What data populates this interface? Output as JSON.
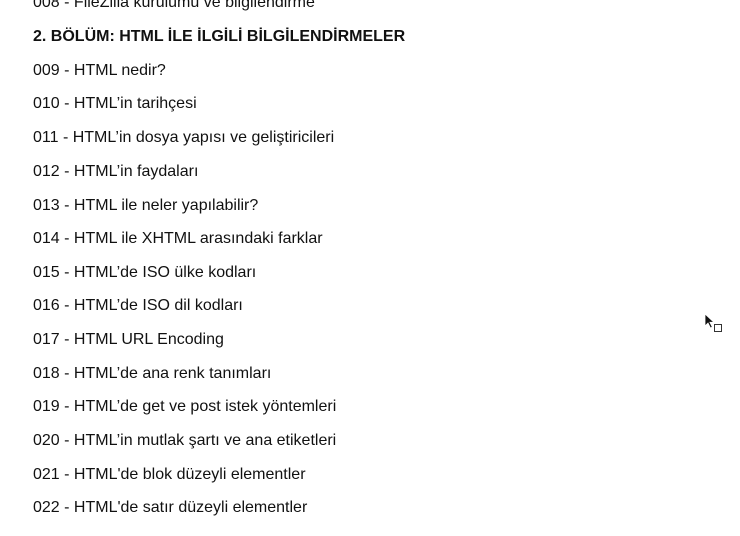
{
  "partial_top_line": "008 - FileZilla kurulumu ve bilgilendirme",
  "section_heading": "2. BÖLÜM: HTML İLE İLGİLİ BİLGİLENDİRMELER",
  "items": [
    "009 - HTML nedir?",
    "010 - HTML’in tarihçesi",
    "011 - HTML’in dosya yapısı ve geliştiricileri",
    "012 - HTML’in faydaları",
    "013 - HTML ile neler yapılabilir?",
    "014 - HTML ile XHTML arasındaki farklar",
    "015 - HTML’de ISO ülke kodları",
    "016 - HTML’de ISO dil kodları",
    "017 - HTML URL Encoding",
    "018 - HTML’de ana renk tanımları",
    "019 - HTML’de get ve post istek yöntemleri",
    "020 - HTML’in mutlak şartı ve ana etiketleri",
    "021 - HTML'de blok düzeyli elementler",
    "022 - HTML'de satır düzeyli elementler"
  ],
  "icons": {
    "cursor": "mouse-pointer-icon"
  }
}
